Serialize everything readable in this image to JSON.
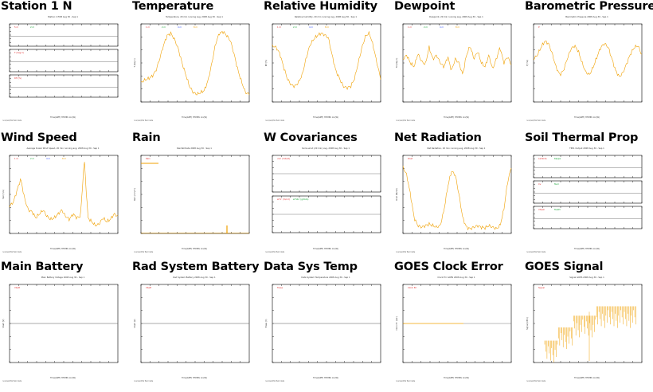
{
  "panels": [
    {
      "title": "Station 1 N",
      "kind": "stack3",
      "subtitle": "Station 1 EOB Aug 30 - Sep 1",
      "leg_a": [
        "5 m",
        "2 m"
      ],
      "leg_b": [
        "T (deg C)"
      ],
      "leg_c": [
        "RH (%)"
      ],
      "xaxis": "Time(GMT) HH:MM, lon(W)"
    },
    {
      "title": "Temperature",
      "kind": "line",
      "subtitle": "Temperature, 20 min running avg, 2008 Aug 30 - Sep 1",
      "legend": [
        "1 m",
        "2 m",
        "4 m",
        "8 m"
      ],
      "ylabel": "T (deg C)",
      "xaxis": "Time(GMT) HH:MM, lon(W)",
      "series": [
        0.25,
        0.28,
        0.3,
        0.33,
        0.4,
        0.55,
        0.72,
        0.85,
        0.88,
        0.8,
        0.68,
        0.5,
        0.35,
        0.2,
        0.12,
        0.1,
        0.12,
        0.15,
        0.28,
        0.5,
        0.75,
        0.88,
        0.9,
        0.85,
        0.78,
        0.6,
        0.4,
        0.25,
        0.12,
        0.1
      ]
    },
    {
      "title": "Relative Humidity",
      "kind": "line",
      "subtitle": "Relative humidity, 20 min running avg, 2008 Aug 30 - Sep 1",
      "legend": [
        "1 m",
        "2 m",
        "4 m",
        "8 m"
      ],
      "ylabel": "RH (%)",
      "xaxis": "Time(GMT) HH:MM, lon(W)",
      "series": [
        0.72,
        0.7,
        0.62,
        0.45,
        0.3,
        0.22,
        0.2,
        0.25,
        0.35,
        0.55,
        0.72,
        0.8,
        0.85,
        0.88,
        0.86,
        0.82,
        0.6,
        0.4,
        0.3,
        0.2,
        0.18,
        0.2,
        0.3,
        0.5,
        0.7,
        0.85,
        0.88,
        0.72,
        0.5,
        0.3
      ]
    },
    {
      "title": "Dewpoint",
      "kind": "line",
      "subtitle": "Dewpoint, 20 min running avg, 2008 Aug 30 - Sep 1",
      "legend": [
        "1 m",
        "2 m",
        "4 m",
        "8 m"
      ],
      "ylabel": "Td (deg C)",
      "xaxis": "Time(GMT) HH:MM, lon(W)",
      "series": [
        0.55,
        0.6,
        0.5,
        0.45,
        0.62,
        0.52,
        0.48,
        0.7,
        0.55,
        0.6,
        0.5,
        0.45,
        0.58,
        0.4,
        0.55,
        0.5,
        0.35,
        0.6,
        0.72,
        0.55,
        0.65,
        0.5,
        0.45,
        0.6,
        0.42,
        0.55,
        0.7,
        0.5,
        0.58,
        0.48
      ]
    },
    {
      "title": "Barometric Pressure",
      "kind": "line",
      "subtitle": "Barometric Pressure 2008 Aug 30 - Sep 1",
      "legend": [
        "P"
      ],
      "ylabel": "P (mb)",
      "xaxis": "Time(GMT) HH:MM, lon(W)",
      "series": [
        0.55,
        0.6,
        0.7,
        0.78,
        0.75,
        0.62,
        0.45,
        0.35,
        0.4,
        0.55,
        0.68,
        0.72,
        0.65,
        0.5,
        0.38,
        0.35,
        0.45,
        0.58,
        0.7,
        0.75,
        0.7,
        0.55,
        0.4,
        0.32,
        0.38,
        0.5,
        0.62,
        0.7,
        0.72,
        0.6
      ]
    },
    {
      "title": "Wind Speed",
      "kind": "line",
      "subtitle": "Average Scalar Wind Speed, 20 min running avg, 2008 Aug 30 - Sep 1",
      "legend": [
        "1 m",
        "2 m",
        "4 m",
        "8 m"
      ],
      "ylabel": "Spd (m/s)",
      "xaxis": "Time(GMT) HH:MM, lon(W)",
      "series": [
        0.35,
        0.4,
        0.55,
        0.7,
        0.45,
        0.3,
        0.28,
        0.2,
        0.25,
        0.3,
        0.22,
        0.18,
        0.2,
        0.25,
        0.3,
        0.22,
        0.18,
        0.25,
        0.2,
        0.22,
        0.95,
        0.2,
        0.15,
        0.1,
        0.12,
        0.2,
        0.15,
        0.18,
        0.25,
        0.22
      ]
    },
    {
      "title": "Rain",
      "kind": "rain",
      "subtitle": "Rainfall Rate 2008 Aug 30 - Sep 1",
      "legend": [
        "Rain"
      ],
      "ylabel": "Rain (mm/hr)",
      "xaxis": "Time(GMT) HH:MM, lon(W)"
    },
    {
      "title": "W Covariances",
      "kind": "stack2",
      "subtitle": "Some wind (20 min) avg, 2008 Aug 30 - Sep 1",
      "leg_a": [
        "u'w' (m2/s2)"
      ],
      "leg_b": [
        "w'tc' (m/s C)",
        "w'h2o' (g/m2s)"
      ],
      "xaxis": "Time(GMT) HH:MM, lon(W)"
    },
    {
      "title": "Net Radiation",
      "kind": "line",
      "subtitle": "Net Radiation, 20 min running avg, 2008 Aug 30 - Sep 1",
      "legend": [
        "Rnet"
      ],
      "ylabel": "Rnet (W/m2)",
      "xaxis": "Time(GMT) HH:MM, lon(W)",
      "series": [
        0.85,
        0.75,
        0.5,
        0.2,
        0.1,
        0.08,
        0.1,
        0.12,
        0.1,
        0.08,
        0.1,
        0.3,
        0.6,
        0.8,
        0.75,
        0.5,
        0.2,
        0.08,
        0.06,
        0.08,
        0.1,
        0.08,
        0.07,
        0.1,
        0.08,
        0.06,
        0.1,
        0.3,
        0.65,
        0.85
      ]
    },
    {
      "title": "Soil Thermal Prop",
      "kind": "stack3",
      "subtitle": "TP01 Output 2008 Aug 30 - Sep 1",
      "leg_a": [
        "Lambda",
        "Kappa"
      ],
      "leg_b": [
        "Cv",
        "Tsoil"
      ],
      "leg_c": [
        "Vheat",
        "Tau63"
      ],
      "xaxis": "Time(GMT) HH:MM, lon(W)"
    },
    {
      "title": "Main Battery",
      "kind": "flat",
      "subtitle": "Main Battery Voltage 2008 Aug 30 - Sep 1",
      "legend": [
        "Vbatt"
      ],
      "ylabel": "Vbatt (V)",
      "xaxis": "Time(GMT) HH:MM, lon(W)"
    },
    {
      "title": "Rad System Battery",
      "kind": "flat",
      "subtitle": "Rad System Battery 2008 Aug 30 - Sep 1",
      "legend": [
        "Vbatt"
      ],
      "ylabel": "Vbatt (V)",
      "xaxis": "Time(GMT) HH:MM, lon(W)"
    },
    {
      "title": "Data Sys Temp",
      "kind": "flat",
      "subtitle": "Data System Temperature 2008 Aug 30 - Sep 1",
      "legend": [
        "Tcase"
      ],
      "ylabel": "Tcase (C)",
      "xaxis": "Time(GMT) HH:MM, lon(W)"
    },
    {
      "title": "GOES Clock Error",
      "kind": "flatorange",
      "subtitle": "Clock Err GOES 2008 Aug 30 - Sep 1",
      "legend": [
        "Clock Err"
      ],
      "ylabel": "Clock Err (sec)",
      "xaxis": "Time(GMT) HH:MM, lon(W)"
    },
    {
      "title": "GOES Signal",
      "kind": "goes",
      "subtitle": "Signal GOES 2008 Aug 30 - Sep 1",
      "legend": [
        "Signal"
      ],
      "ylabel": "Signal (dBm)",
      "xaxis": "Time(GMT) HH:MM, lon(W)"
    }
  ],
  "colors": {
    "trace": "#f0a000",
    "frame": "#000000",
    "legend_blue": "#3050ff",
    "legend_green": "#10a030",
    "legend_red": "#e03030"
  }
}
